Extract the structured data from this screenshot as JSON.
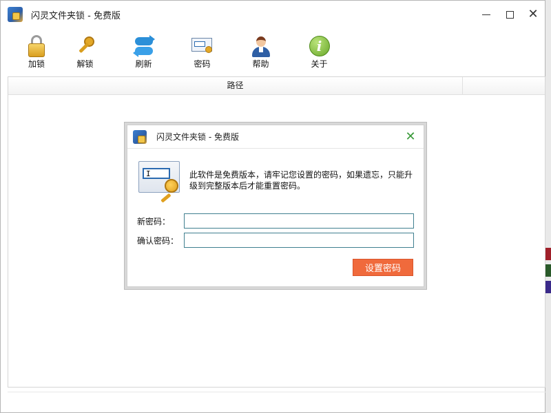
{
  "window": {
    "title": "闪灵文件夹锁 - 免费版"
  },
  "toolbar": {
    "items": [
      {
        "label": "加锁",
        "icon": "lock-icon"
      },
      {
        "label": "解锁",
        "icon": "key-icon"
      },
      {
        "label": "刷新",
        "icon": "refresh-icon"
      },
      {
        "label": "密码",
        "icon": "password-icon"
      },
      {
        "label": "帮助",
        "icon": "help-person-icon"
      },
      {
        "label": "关于",
        "icon": "info-icon"
      }
    ]
  },
  "list": {
    "columns": [
      "路径",
      ""
    ]
  },
  "dialog": {
    "title": "闪灵文件夹锁 - 免费版",
    "close": "✕",
    "message": "此软件是免费版本，请牢记您设置的密码，如果遗忘，只能升级到完整版本后才能重置密码。",
    "cursor": "I",
    "fields": {
      "new_password_label": "新密码：",
      "new_password_value": "",
      "confirm_password_label": "确认密码：",
      "confirm_password_value": ""
    },
    "submit_label": "设置密码"
  },
  "about_glyph": "i",
  "colors": {
    "accent_button": "#f06a3c",
    "dialog_close": "#3a9a3a",
    "input_border": "#3f7f8f"
  }
}
